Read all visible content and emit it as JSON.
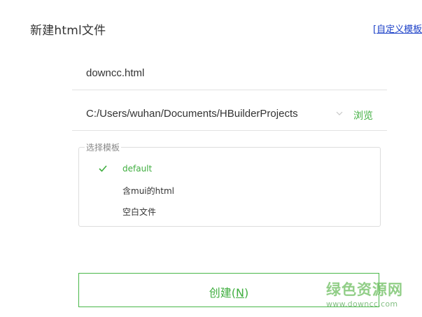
{
  "dialog": {
    "title": "新建html文件",
    "custom_template_link": "[自定义模板"
  },
  "filename": {
    "value": "downcc.html"
  },
  "location": {
    "value": "C:/Users/wuhan/Documents/HBuilderProjects",
    "dropdown_icon": "chevron-down-icon",
    "browse_label": "浏览"
  },
  "template_section": {
    "legend": "选择模板",
    "items": [
      {
        "label": "default",
        "selected": true
      },
      {
        "label": "含mui的html",
        "selected": false
      },
      {
        "label": "空白文件",
        "selected": false
      }
    ],
    "check_icon": "check-icon"
  },
  "create_button": {
    "label": "创建(",
    "hotkey": "N",
    "label_suffix": ")"
  },
  "watermark": {
    "title": "绿色资源网",
    "url": "www.downcc.com"
  },
  "colors": {
    "accent_green": "#3fae3f",
    "link_blue": "#1a3fc7",
    "border": "#dddddd"
  }
}
